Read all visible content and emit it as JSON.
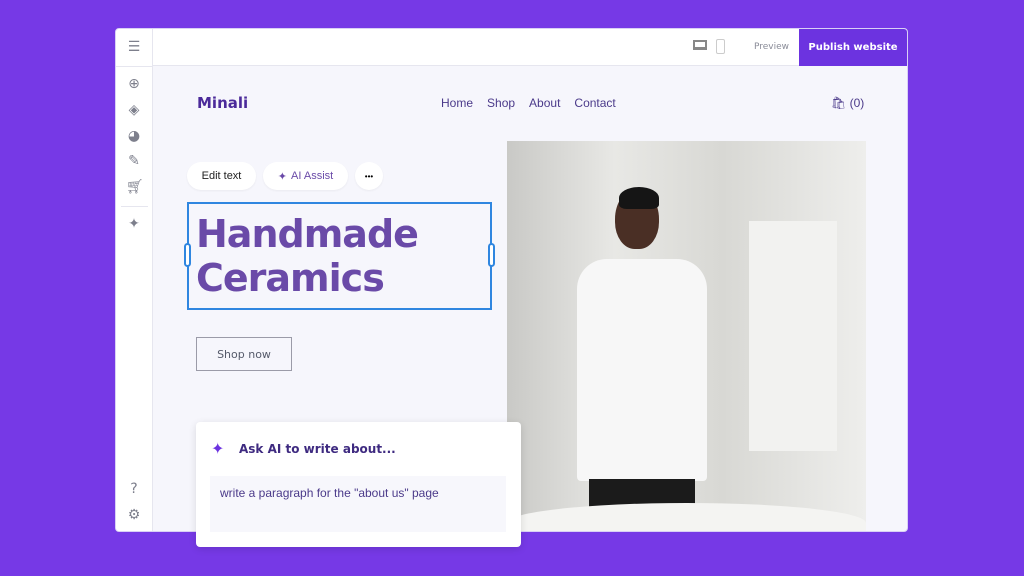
{
  "toolbar": {
    "preview_label": "Preview",
    "publish_label": "Publish website"
  },
  "site": {
    "logo": "Minali",
    "nav": [
      "Home",
      "Shop",
      "About",
      "Contact"
    ],
    "cart_count": "(0)"
  },
  "editor": {
    "edit_text": "Edit text",
    "ai_assist": "AI Assist",
    "more": "•••"
  },
  "hero": {
    "title_line1": "Handmade",
    "title_line2": "Ceramics",
    "cta": "Shop now"
  },
  "ai_card": {
    "title": "Ask AI to write about...",
    "prompt": "write a paragraph for the \"about us\" page"
  },
  "colors": {
    "background": "#7639e6",
    "accent": "#6c33e0",
    "selection": "#2f86e0",
    "heading": "#6a4aa8"
  }
}
